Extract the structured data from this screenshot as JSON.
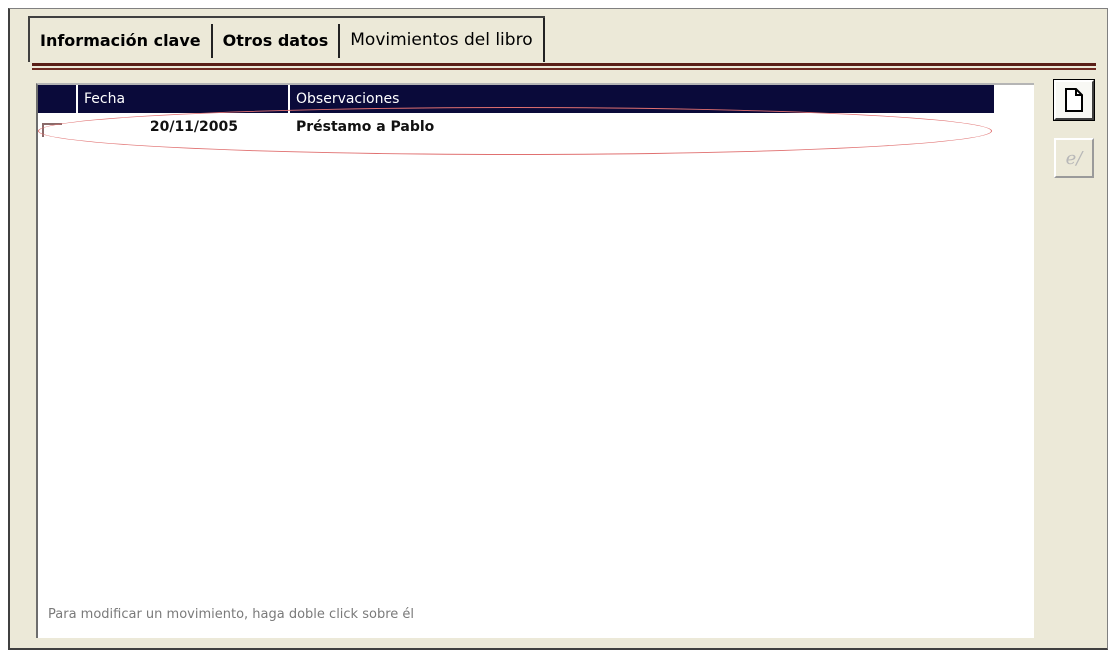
{
  "tabs": [
    {
      "label": "Información clave"
    },
    {
      "label": "Otros datos"
    },
    {
      "label": "Movimientos del libro"
    }
  ],
  "table": {
    "columns": [
      "Fecha",
      "Observaciones"
    ],
    "rows": [
      {
        "fecha": "20/11/2005",
        "observaciones": "Préstamo a Pablo"
      }
    ]
  },
  "hint": "Para modificar un movimiento, haga doble click sobre él",
  "buttons": {
    "new_icon": "new-document-icon",
    "edit_icon": "edit-icon",
    "edit_glyph": "e/"
  },
  "colors": {
    "header_bg": "#0a0a3a",
    "rule": "#5a1f18",
    "highlight": "#e07070"
  }
}
